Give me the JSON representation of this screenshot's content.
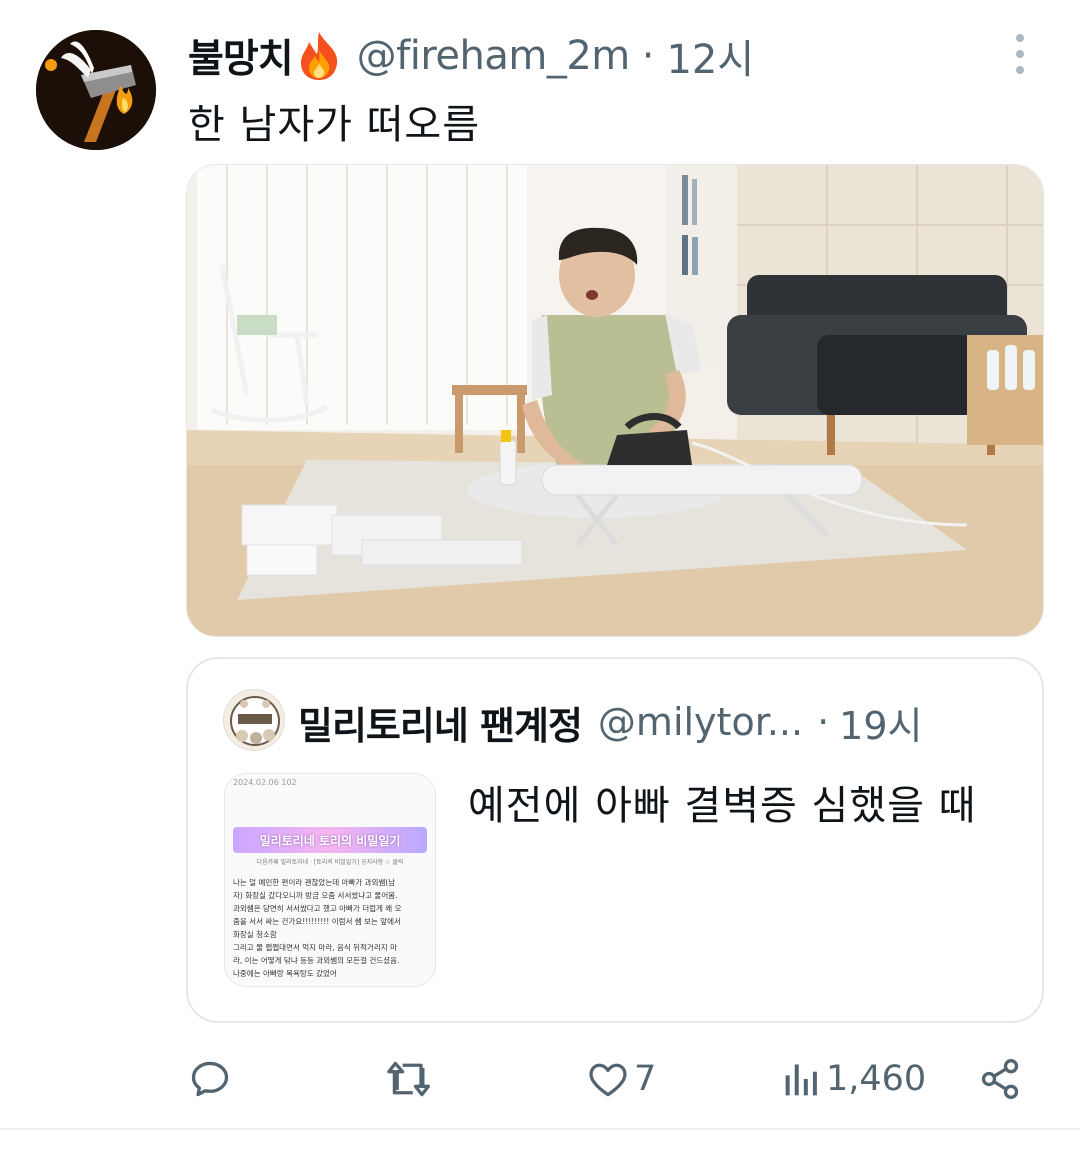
{
  "author": {
    "display_name": "불망치",
    "handle": "@fireham_2m",
    "time": "12시",
    "separator": "·",
    "emoji": "fire-emoji",
    "avatar": "hammer-avatar"
  },
  "tweet": {
    "text": "한 남자가 떠오름",
    "media": "photo of a man ironing on a low ironing board in a living room"
  },
  "quote": {
    "display_name": "밀리토리네 팬계정",
    "handle": "@milytor...",
    "separator": "·",
    "time": "19시",
    "text": "예전에 아빠 결벽증 심했을 때",
    "thumbnail": {
      "date": "2024.02.06    102",
      "banner": "밀리토리네 토리의 비밀일기",
      "subtitle": "다음카페 밀리토리네 · [토리의 비밀일기] 공지사항 ☆ 클릭",
      "lines": [
        "나는 덜 예민한 편이라 괜찮았는데 아빠가 과외쌤(남",
        "자) 화장실 갔다오니까 방금 오줌 서서쌌냐고 물어봄.",
        "과외쌤은 당연히 서서쌌다고 했고 아빠가 더럽게 왜 오",
        "줌을 서서 싸는 건가요!!!!!!!!! 이럼서 쌤 보는 앞에서",
        "화장실 청소함",
        "그리고 물 쩝쩝대면서 먹지 마라, 음식 뒤적거리지 마",
        "라, 이는 어떻게 닦냐 등등 과외쌤의 모든걸 건드셨음.",
        "나중에는 아빠랑 목욕탕도 갔었어"
      ]
    }
  },
  "actions": {
    "reply": {
      "icon": "reply-icon",
      "count": ""
    },
    "retweet": {
      "icon": "retweet-icon",
      "count": ""
    },
    "like": {
      "icon": "heart-icon",
      "count": "7"
    },
    "views": {
      "icon": "views-icon",
      "count": "1,460"
    },
    "share": {
      "icon": "share-icon",
      "count": ""
    }
  },
  "colors": {
    "text": "#0f1419",
    "secondary": "#536471",
    "border": "#e4e8eb"
  }
}
